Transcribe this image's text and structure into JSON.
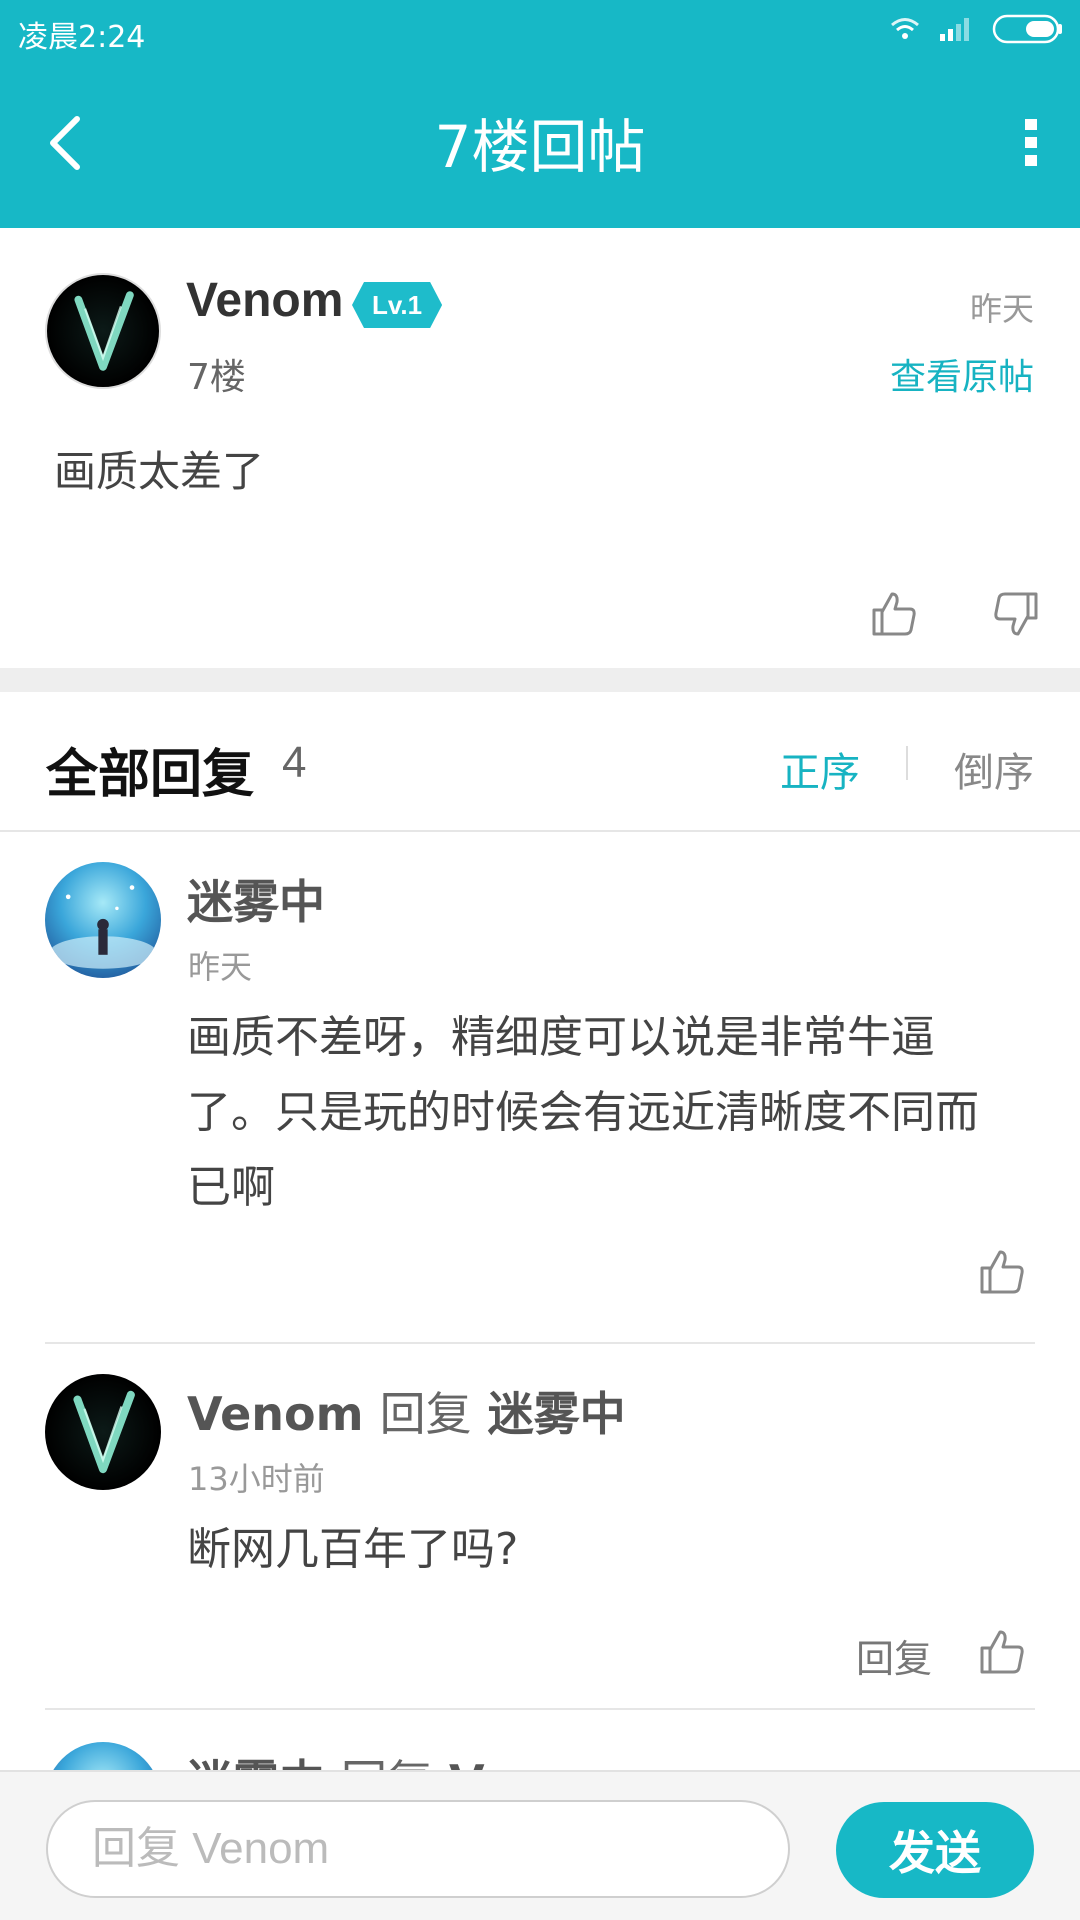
{
  "status_bar": {
    "time": "凌晨2:24",
    "icons": [
      "wifi-icon",
      "signal-icon",
      "battery-icon"
    ]
  },
  "header": {
    "title": "7楼回帖",
    "back_icon": "back-arrow-icon",
    "more_icon": "more-vertical-icon"
  },
  "post": {
    "author": "Venom",
    "level": "Lv.1",
    "floor": "7楼",
    "time": "昨天",
    "view_original": "查看原帖",
    "content": "画质太差了"
  },
  "replies": {
    "title": "全部回复",
    "count": "4",
    "sort_asc": "正序",
    "sort_desc": "倒序",
    "items": [
      {
        "author": "迷雾中",
        "time": "昨天",
        "content": "画质不差呀，精细度可以说是非常牛逼了。只是玩的时候会有远近清晰度不同而已啊"
      },
      {
        "author": "Venom",
        "reply_word": "回复",
        "reply_to": "迷雾中",
        "time": "13小时前",
        "content": "断网几百年了吗?",
        "reply_action": "回复"
      },
      {
        "author": "迷雾中",
        "reply_word": "回复",
        "reply_to": "Venom"
      }
    ]
  },
  "composer": {
    "placeholder": "回复 Venom",
    "send_label": "发送"
  },
  "colors": {
    "accent": "#17b8c6",
    "badge": "#1ebccb",
    "divider": "#e6e6e6"
  }
}
